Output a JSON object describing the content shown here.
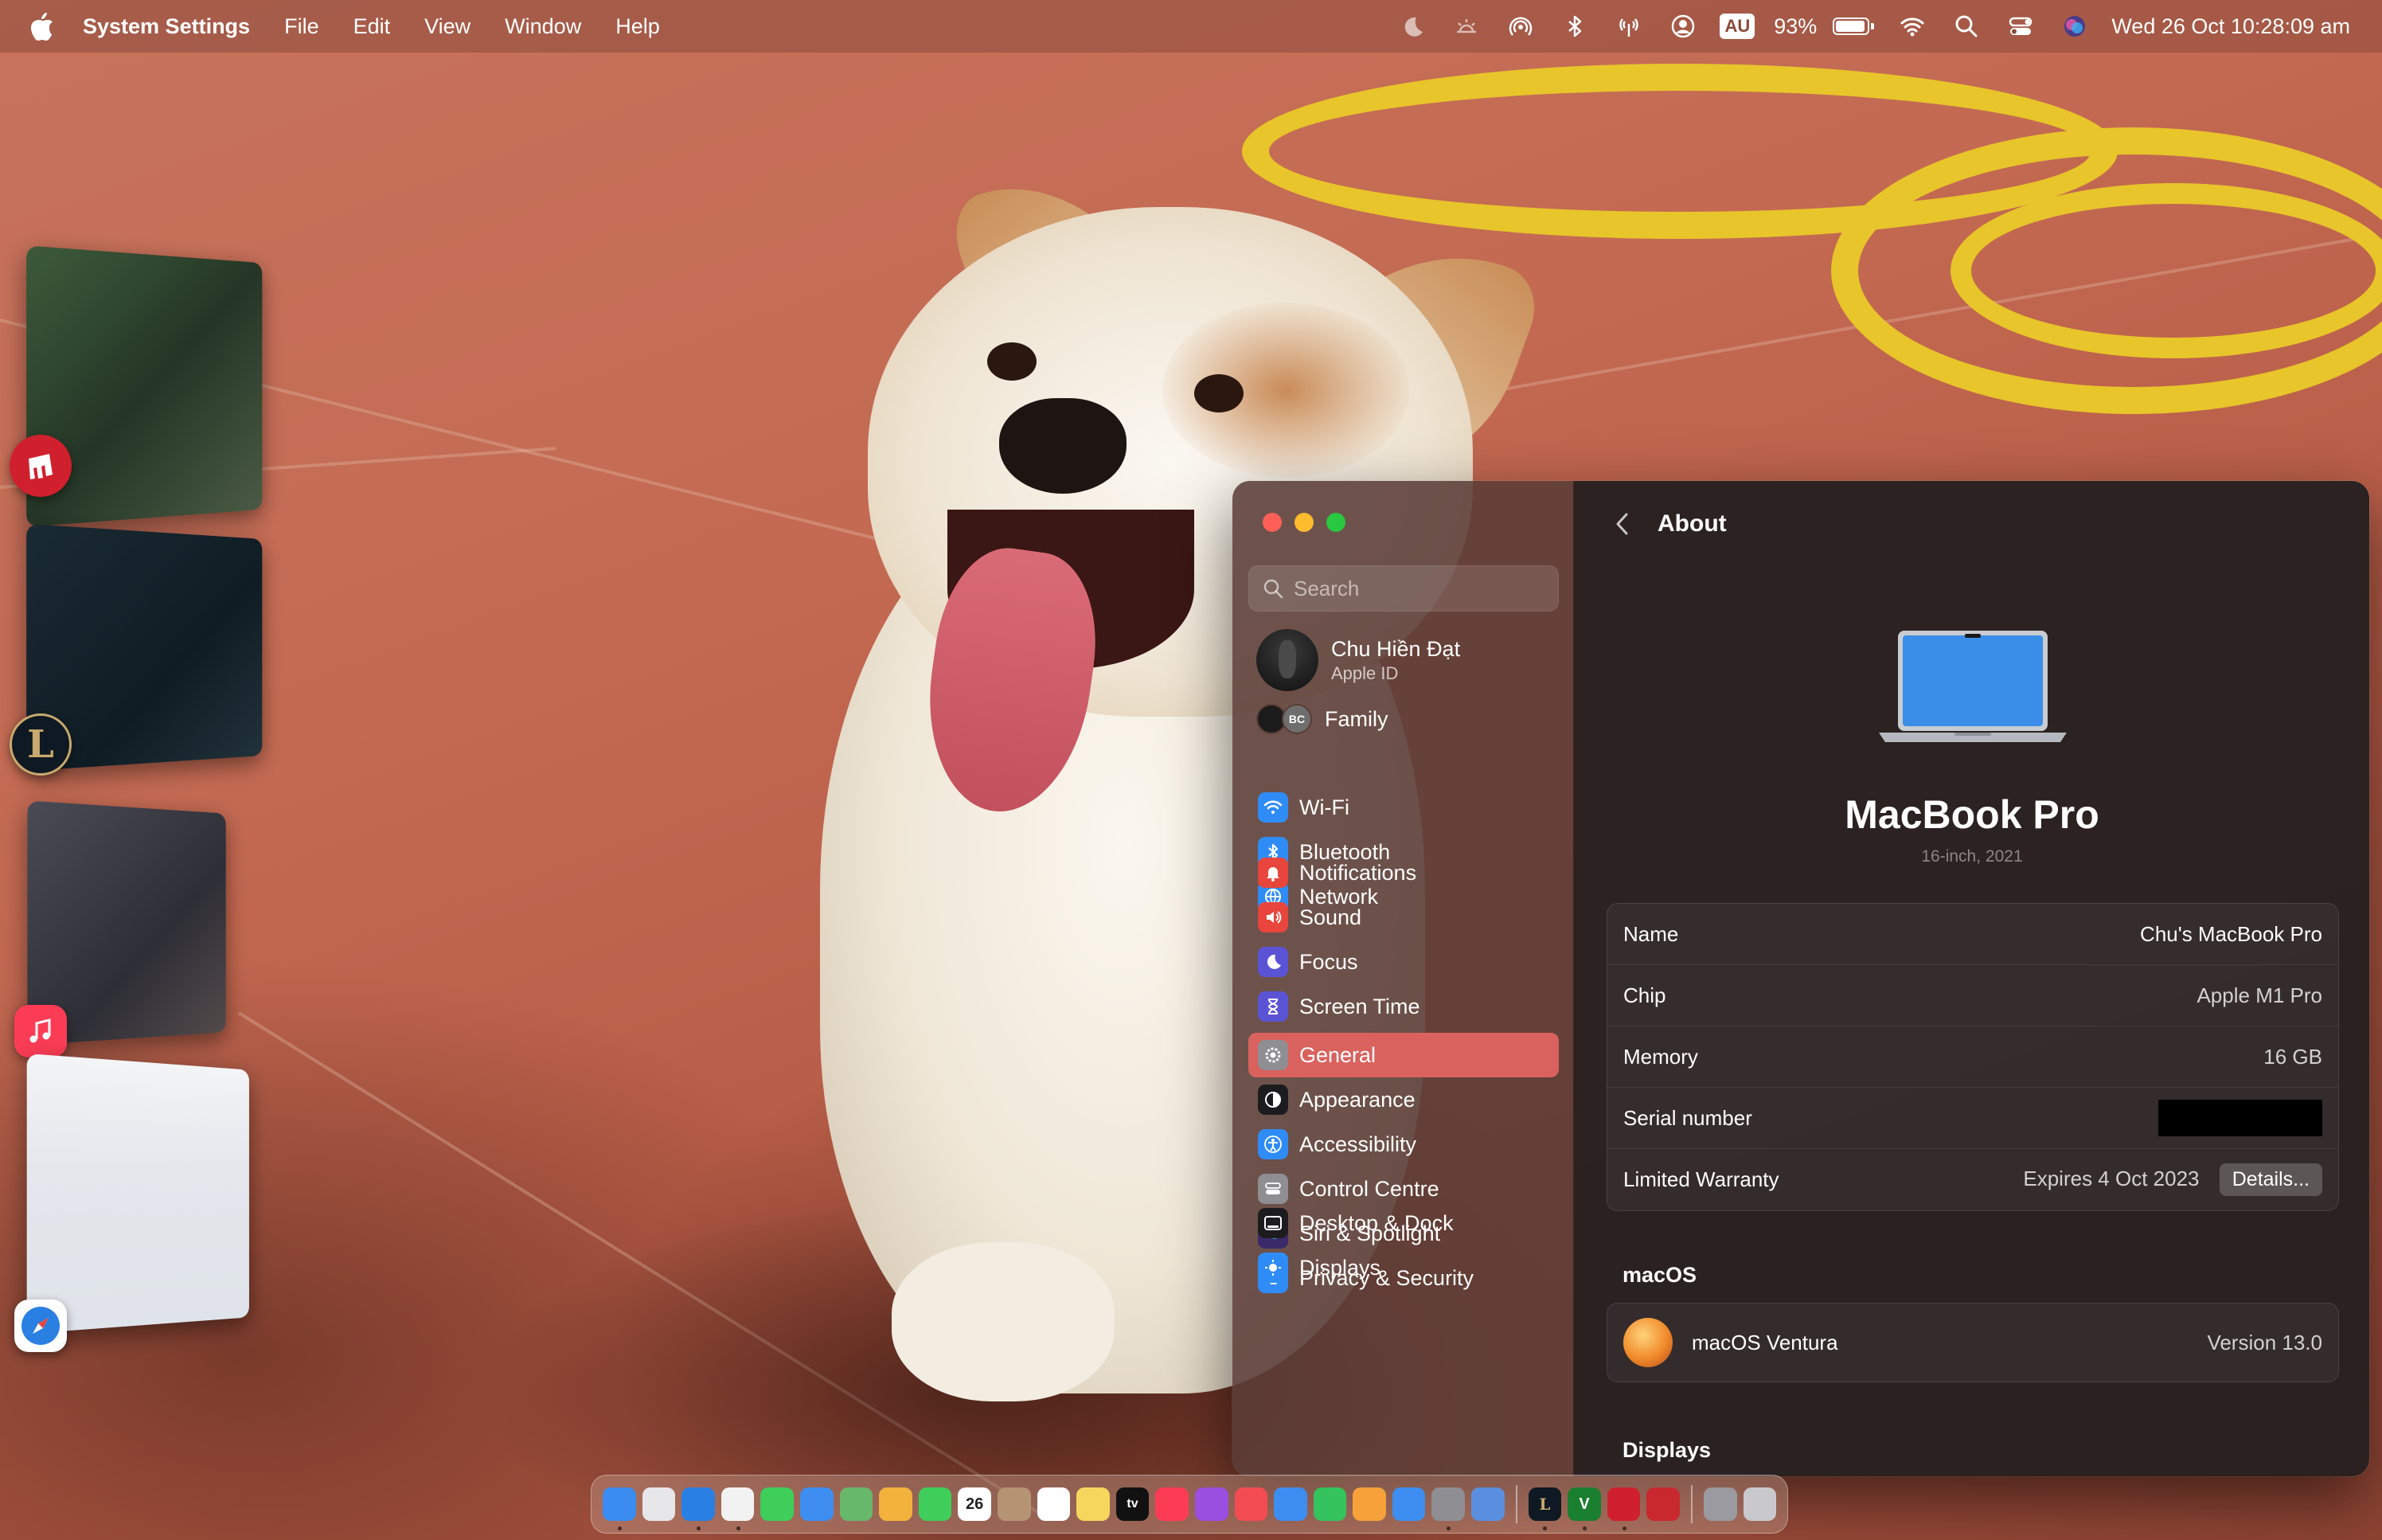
{
  "menubar": {
    "app_name": "System Settings",
    "menus": [
      "File",
      "Edit",
      "View",
      "Window",
      "Help"
    ],
    "input_source": "AU",
    "battery_percent": "93%",
    "battery_level": 0.93,
    "datetime": "Wed 26 Oct  10:28:09 am"
  },
  "window": {
    "search_placeholder": "Search",
    "profile": {
      "name": "Chu Hiền Đạt",
      "subtitle": "Apple ID"
    },
    "family": {
      "label": "Family",
      "initials": "BC"
    },
    "sidebar_groups": [
      [
        {
          "label": "Wi-Fi",
          "icon": "wifi-icon",
          "color": "#2f8cf7"
        },
        {
          "label": "Bluetooth",
          "icon": "bluetooth-icon",
          "color": "#2f8cf7"
        },
        {
          "label": "Network",
          "icon": "globe-icon",
          "color": "#2f8cf7"
        }
      ],
      [
        {
          "label": "Notifications",
          "icon": "bell-icon",
          "color": "#e8453c"
        },
        {
          "label": "Sound",
          "icon": "speaker-icon",
          "color": "#e8453c"
        },
        {
          "label": "Focus",
          "icon": "moon-icon",
          "color": "#5b53d6"
        },
        {
          "label": "Screen Time",
          "icon": "hourglass-icon",
          "color": "#5b53d6"
        }
      ],
      [
        {
          "label": "General",
          "icon": "gear-icon",
          "color": "#8e8e93",
          "active": true
        },
        {
          "label": "Appearance",
          "icon": "appearance-icon",
          "color": "#1c1c1e"
        },
        {
          "label": "Accessibility",
          "icon": "accessibility-icon",
          "color": "#2f8cf7"
        },
        {
          "label": "Control Centre",
          "icon": "control-centre-icon",
          "color": "#8e8e93"
        },
        {
          "label": "Siri & Spotlight",
          "icon": "siri-icon",
          "color": "#3a2a6a"
        },
        {
          "label": "Privacy & Security",
          "icon": "hand-icon",
          "color": "#2f8cf7"
        }
      ],
      [
        {
          "label": "Desktop & Dock",
          "icon": "dock-icon",
          "color": "#1c1c1e"
        },
        {
          "label": "Displays",
          "icon": "display-icon",
          "color": "#2f8cf7"
        }
      ]
    ],
    "about": {
      "title": "About",
      "device_name": "MacBook Pro",
      "device_subtitle": "16-inch, 2021",
      "rows": [
        {
          "label": "Name",
          "value": "Chu's MacBook Pro"
        },
        {
          "label": "Chip",
          "value": "Apple M1 Pro"
        },
        {
          "label": "Memory",
          "value": "16 GB"
        },
        {
          "label": "Serial number",
          "value": ""
        },
        {
          "label": "Limited Warranty",
          "value": "Expires 4 Oct 2023",
          "button": "Details..."
        }
      ],
      "macos_section": "macOS",
      "macos_name": "macOS Ventura",
      "macos_version": "Version 13.0",
      "displays_section": "Displays"
    }
  },
  "dock": {
    "calendar_day": "26",
    "apple_tv_label": "tv",
    "league_label": "L",
    "vim_label": "V",
    "apps": [
      {
        "name": "finder-icon",
        "color": "#3b8cf0",
        "running": true
      },
      {
        "name": "launchpad-icon",
        "color": "#e7e7ea"
      },
      {
        "name": "safari-icon",
        "color": "#2a7fe3",
        "running": true
      },
      {
        "name": "chrome-icon",
        "color": "#f2f2f2",
        "running": true
      },
      {
        "name": "messages-icon",
        "color": "#3fce5a"
      },
      {
        "name": "mail-icon",
        "color": "#3d8ef0"
      },
      {
        "name": "maps-icon",
        "color": "#68b86b"
      },
      {
        "name": "photos-icon",
        "color": "#f3b23c"
      },
      {
        "name": "facetime-icon",
        "color": "#3fce5a"
      },
      {
        "name": "calendar-icon",
        "color": "#ffffff"
      },
      {
        "name": "contacts-icon",
        "color": "#b59473"
      },
      {
        "name": "reminders-icon",
        "color": "#ffffff"
      },
      {
        "name": "notes-icon",
        "color": "#f6d65d"
      },
      {
        "name": "apple-tv-icon",
        "color": "#111111"
      },
      {
        "name": "music-icon",
        "color": "#fc3c55"
      },
      {
        "name": "podcasts-icon",
        "color": "#9b4fe0"
      },
      {
        "name": "news-icon",
        "color": "#f24c52"
      },
      {
        "name": "keynote-icon",
        "color": "#3d8ef0"
      },
      {
        "name": "numbers-icon",
        "color": "#34c35c"
      },
      {
        "name": "pages-icon",
        "color": "#f6a13a"
      },
      {
        "name": "app-store-icon",
        "color": "#3d8ef0"
      },
      {
        "name": "system-settings-icon",
        "color": "#8e8e93",
        "running": true
      },
      {
        "name": "preview-icon",
        "color": "#5a8fe0"
      }
    ],
    "apps2": [
      {
        "name": "league-of-legends-icon",
        "color": "#0f1923",
        "running": true
      },
      {
        "name": "vim-icon",
        "color": "#1a7f2e",
        "running": true
      },
      {
        "name": "riot-client-icon",
        "color": "#d0202d",
        "running": true
      },
      {
        "name": "photo-booth-icon",
        "color": "#c8282e"
      }
    ],
    "apps3": [
      {
        "name": "downloads-folder-icon",
        "color": "#9a9aa0"
      },
      {
        "name": "trash-icon",
        "color": "#c9c9cd"
      }
    ]
  }
}
